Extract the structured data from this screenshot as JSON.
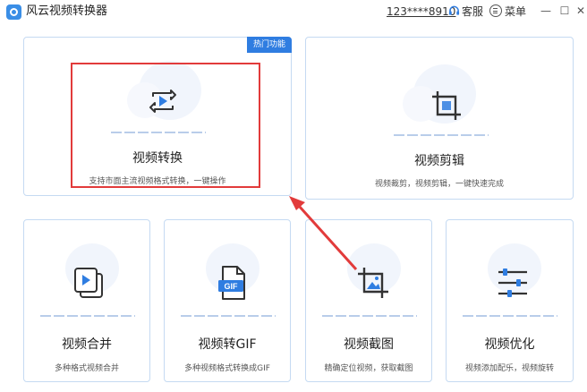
{
  "app": {
    "title": "风云视频转换器",
    "account": "123****8910",
    "service_label": "客服",
    "menu_label": "菜单",
    "minimize_glyph": "—",
    "maximize_glyph": "☐",
    "close_glyph": "✕"
  },
  "cards": {
    "convert": {
      "title": "视频转换",
      "desc": "支持市面主流视频格式转换，一键操作",
      "badge": "热门功能",
      "icon": "video-convert-icon"
    },
    "edit": {
      "title": "视频剪辑",
      "desc": "视频裁剪，视频剪辑，一键快速完成",
      "icon": "crop-icon"
    },
    "merge": {
      "title": "视频合并",
      "desc": "多种格式视频合并",
      "icon": "video-merge-icon"
    },
    "gif": {
      "title": "视频转GIF",
      "desc": "多种视频格式转换成GIF",
      "icon": "gif-file-icon",
      "icon_text": "GIF"
    },
    "screenshot": {
      "title": "视频截图",
      "desc": "精确定位视频，获取截图",
      "icon": "crop-image-icon"
    },
    "optimize": {
      "title": "视频优化",
      "desc": "视频添加配乐，视频旋转",
      "icon": "sliders-icon"
    }
  },
  "colors": {
    "accent": "#2f7de1",
    "card_border": "#c5daf2",
    "highlight": "#e23b3b"
  }
}
